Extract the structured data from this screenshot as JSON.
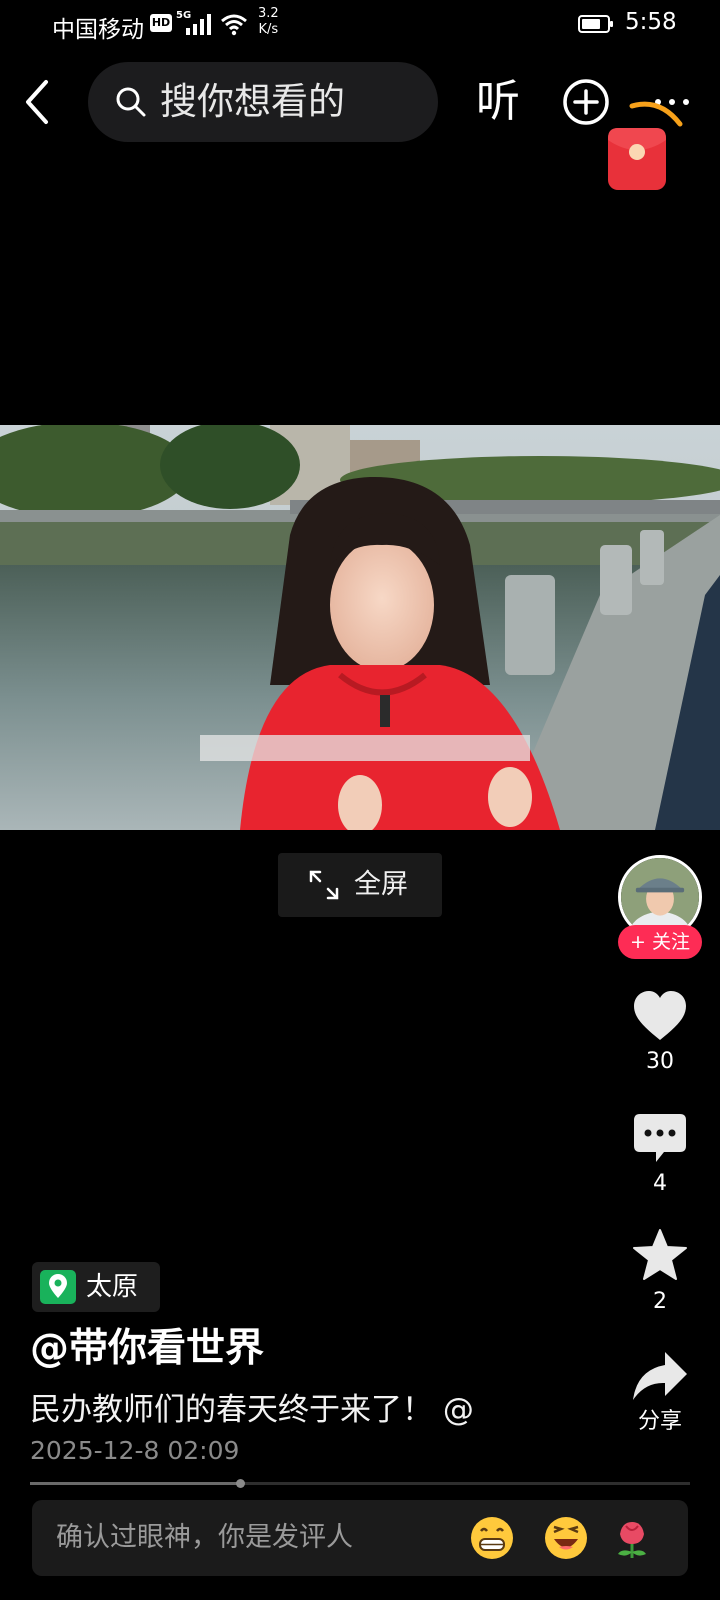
{
  "status_bar": {
    "carrier": "中国移动",
    "hd": "HD",
    "network": "5G",
    "speed_value": "3.2",
    "speed_unit": "K/s",
    "time": "5:58"
  },
  "top_nav": {
    "search_placeholder": "搜你想看的",
    "listen_label": "听",
    "icons": [
      "back-icon",
      "search-icon",
      "plus-icon",
      "more-icon",
      "red-packet-icon"
    ]
  },
  "video": {
    "fullscreen_label": "全屏"
  },
  "sidebar": {
    "follow_label": "+ 关注",
    "like_count": "30",
    "comment_count": "4",
    "favorite_count": "2",
    "share_label": "分享",
    "accent": "#fe2c55"
  },
  "post": {
    "location": "太原",
    "location_color": "#19b25b",
    "author": "@带你看世界",
    "caption": "民办教师们的春天终于来了！ @",
    "timestamp": "2025-12-8 02:09"
  },
  "playback": {
    "progress": 0.318
  },
  "comment_bar": {
    "placeholder": "确认过眼神，你是发评人",
    "emojis": [
      "grin-emoji",
      "laugh-emoji",
      "rose-emoji"
    ]
  }
}
